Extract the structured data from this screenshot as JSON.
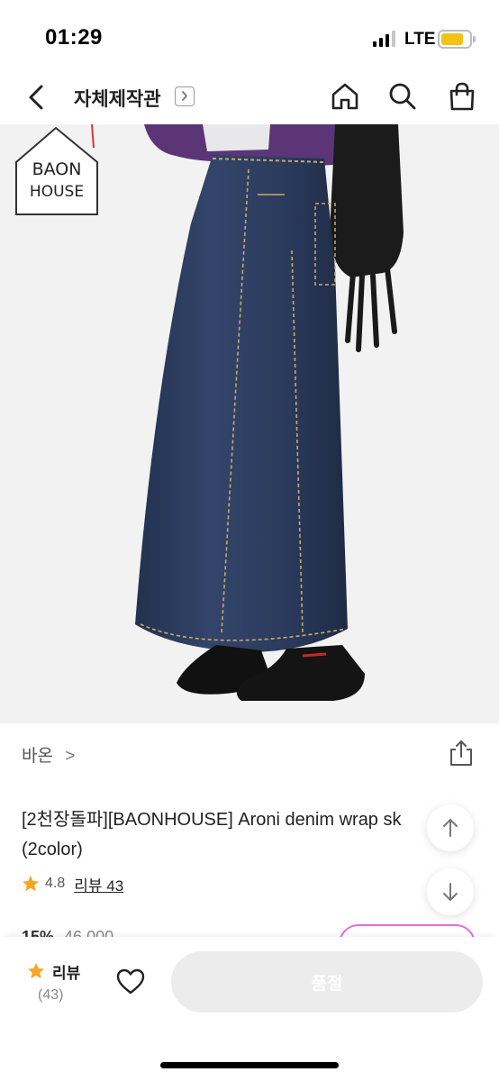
{
  "status_bar": {
    "time": "01:29",
    "network": "LTE",
    "signal_bars": 4,
    "signal_bars_filled": 3,
    "battery_level": 0.8,
    "battery_color": "#f3c213"
  },
  "nav": {
    "title": "자체제작관",
    "icons": [
      "back-icon",
      "chevron-right-icon",
      "home-icon",
      "search-icon",
      "shopping-bag-icon"
    ]
  },
  "hero": {
    "logo_line1": "BAON",
    "logo_line2": "HOUSE"
  },
  "product": {
    "brand": "바온",
    "brand_chevron": ">",
    "title": "[2천장돌파][BAONHOUSE] Aroni denim wrap sk",
    "title_line2": "(2color)",
    "rating": "4.8",
    "review_link": "리뷰 43",
    "discount": "15%",
    "original_price": "46,000"
  },
  "bottom_bar": {
    "review_label": "리뷰",
    "review_count": "(43)",
    "soldout_label": "품절"
  },
  "colors": {
    "star": "#f5a623",
    "coupon_border": "#e66be0",
    "soldout_bg": "#ececec"
  }
}
